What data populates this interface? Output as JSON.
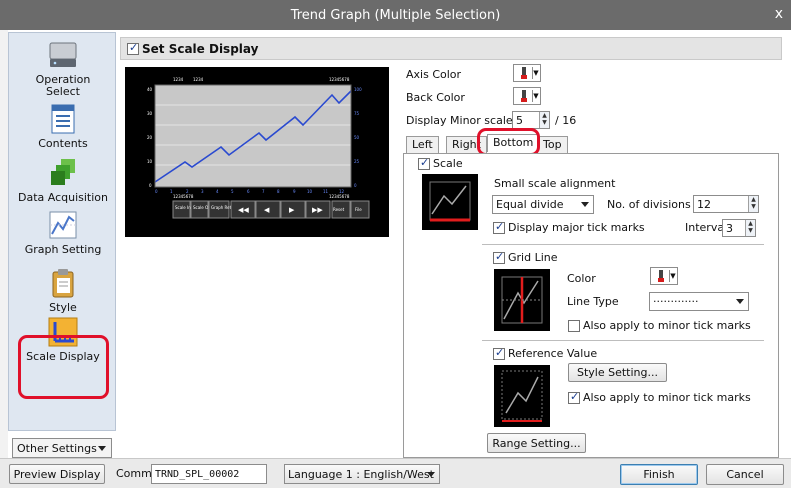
{
  "window": {
    "title": "Trend Graph (Multiple Selection)",
    "close": "x"
  },
  "sidebar": {
    "items": [
      {
        "label": "Operation\nSelect",
        "icon": "drive-icon"
      },
      {
        "label": "Contents",
        "icon": "document-icon"
      },
      {
        "label": "Data Acquisition",
        "icon": "data-acquisition-icon"
      },
      {
        "label": "Graph Setting",
        "icon": "graph-icon"
      },
      {
        "label": "Style",
        "icon": "clipboard-icon"
      },
      {
        "label": "Scale Display",
        "icon": "scale-icon"
      }
    ],
    "selected": "Scale Display",
    "other_settings": "Other Settings"
  },
  "header": {
    "set_scale_display": "Set Scale Display",
    "checked": true
  },
  "preview": {
    "top_labels": [
      "1234",
      "1234",
      "12345678"
    ],
    "left_ticks": [
      "40",
      "30",
      "20",
      "10",
      "0"
    ],
    "right_ticks": [
      "100",
      "75",
      "50",
      "25",
      "0"
    ],
    "bottom_ticks": [
      "0",
      "1",
      "2",
      "3",
      "4",
      "5",
      "6",
      "7",
      "8",
      "9",
      "10",
      "11",
      "12"
    ],
    "buttons": [
      "Scale\nIn",
      "Scale\nOut",
      "Graph\nReturn",
      "◀◀",
      "◀",
      "▶",
      "▶▶",
      "Reset",
      "File"
    ],
    "bottom_left_label": "12345678",
    "bottom_right_label": "12345678"
  },
  "axis": {
    "axis_color_label": "Axis Color",
    "back_color_label": "Back Color",
    "minor_scale_label": "Display Minor scale",
    "minor_scale_value": "5",
    "minor_scale_max": "/ 16"
  },
  "tabs": [
    "Left",
    "Right",
    "Bottom",
    "Top"
  ],
  "active_tab": "Bottom",
  "scale": {
    "label": "Scale",
    "small_scale_alignment": "Small scale alignment",
    "alignment_value": "Equal divide",
    "divisions_label": "No. of divisions",
    "divisions_value": "12",
    "major_tick_label": "Display major tick marks",
    "interval_label": "Interval",
    "interval_value": "3"
  },
  "grid_line": {
    "label": "Grid Line",
    "color_label": "Color",
    "line_type_label": "Line Type",
    "line_type_value": "·············",
    "apply_minor": "Also apply to minor tick marks"
  },
  "reference_value": {
    "label": "Reference Value",
    "style_setting": "Style Setting...",
    "apply_minor": "Also apply to minor tick marks"
  },
  "range_setting": "Range Setting...",
  "bottom": {
    "preview_display": "Preview Display",
    "comm_label": "Comm",
    "comm_value": "TRND_SPL_00002",
    "language": "Language 1 : English/West",
    "finish": "Finish",
    "cancel": "Cancel"
  },
  "colors": {
    "highlight": "#e0102a",
    "sidebar_bg": "#dfe7f1",
    "titlebar": "#6b6b6b",
    "plot_line": "#2a4ad0"
  }
}
